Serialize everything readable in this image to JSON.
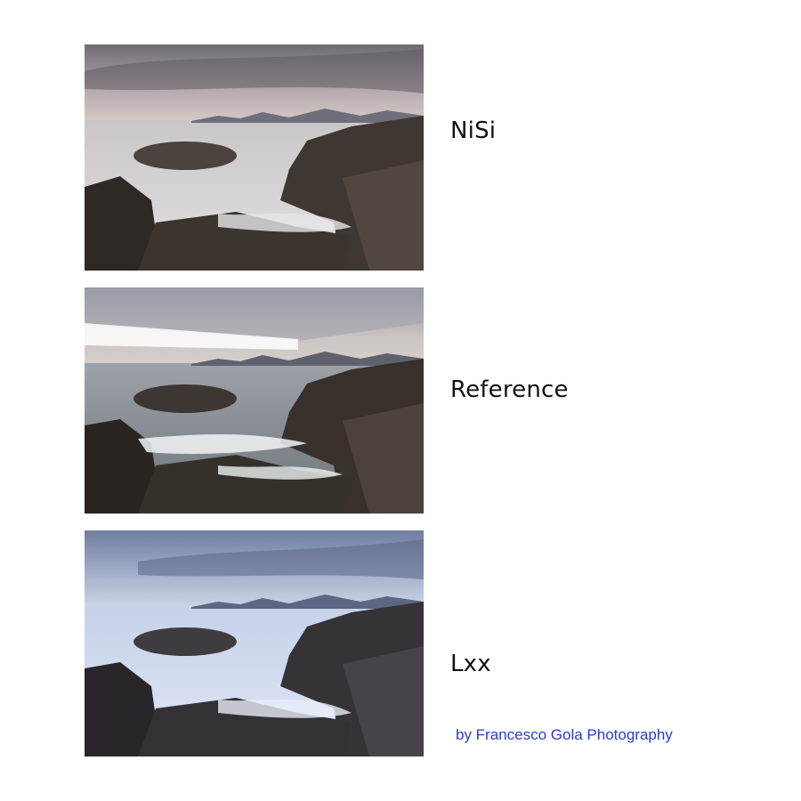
{
  "panels": [
    {
      "label": "NiSi",
      "description": "long-exposure seascape, warm neutral tones",
      "tint": "#8e8f94"
    },
    {
      "label": "Reference",
      "description": "short-exposure seascape with visible waves",
      "tint": "#9ea4aa"
    },
    {
      "label": "Lxx",
      "description": "long-exposure seascape, cool blue cast",
      "tint": "#8fa3c7"
    }
  ],
  "credit": "by Francesco Gola Photography",
  "colors": {
    "background": "#ffffff",
    "label_text": "#111111",
    "credit_text": "#2b3bd1"
  }
}
